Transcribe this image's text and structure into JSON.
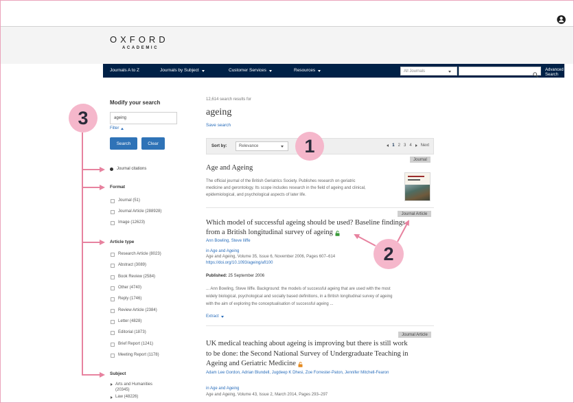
{
  "header": {
    "user_icon": "user-circle-icon"
  },
  "logo": {
    "word": "OXFORD",
    "sub": "ACADEMIC"
  },
  "nav": {
    "items": [
      {
        "label": "Journals A to Z",
        "has_caret": false
      },
      {
        "label": "Journals by Subject",
        "has_caret": true
      },
      {
        "label": "Customer Services",
        "has_caret": true
      },
      {
        "label": "Resources",
        "has_caret": true
      }
    ],
    "scope": "All Journals",
    "advanced_line1": "Advanced",
    "advanced_line2": "Search",
    "search_icon": "search-icon",
    "background": "#002147"
  },
  "sidebar": {
    "title": "Modify your search",
    "query": "ageing",
    "filter_label": "Filter",
    "search_button": "Search",
    "clear_button": "Clear",
    "scope_option": "Journal citations",
    "format": {
      "heading": "Format",
      "options": [
        "Journal (51)",
        "Journal Article (288928)",
        "Image (12623)"
      ]
    },
    "article_type": {
      "heading": "Article type",
      "options": [
        "Research Article (8023)",
        "Abstract (3089)",
        "Book Review (2584)",
        "Other (4740)",
        "Reply (1746)",
        "Review Article (2384)",
        "Letter (4828)",
        "Editorial (1873)",
        "Brief Report (1241)",
        "Meeting Report (1178)"
      ]
    },
    "subject": {
      "heading": "Subject",
      "options": [
        "Arts and Humanities (20345)",
        "Law (48226)"
      ]
    }
  },
  "results": {
    "count_text": "12,614 search results for",
    "query": "ageing",
    "save_search": "Save search",
    "sort_label": "Sort by:",
    "sort_value": "Relevance",
    "pages": [
      "1",
      "2",
      "3",
      "4"
    ],
    "next": "Next",
    "items": [
      {
        "type": "Journal",
        "title": "Age and Ageing",
        "desc_lines": [
          "The official journal of the British Geriatrics Society. Publishes research on geriatric",
          "medicine and gerontology. Its scope includes research in the field of ageing and clinical,",
          "epidemiological, and psychological aspects of later life."
        ],
        "cover": "journal-cover-image"
      },
      {
        "type": "Journal Article",
        "title_lines": [
          "Which model of successful ageing should be used? Baseline findings",
          "from a British longitudinal survey of ageing"
        ],
        "access_icon": "open-access-lock-icon",
        "authors": "Ann Bowling, Steve Iliffe",
        "in_journal": "in Age and Ageing",
        "citation": "Age and Ageing, Volume 35, Issue 6, November 2006, Pages 607–614",
        "doi": "https://doi.org/10.1093/ageing/afl100",
        "published_label": "Published:",
        "published_date": "25 September 2006",
        "snippet_lines": [
          "... Ann Bowling, Steve Iliffe. Background: the models of successful ageing that are used with the most",
          "widely biological, psychological and socially based definitions, in a British longitudinal survey of ageing",
          "with the aim of exploring the conceptualisation of successful ageing ..."
        ],
        "extract": "Extract"
      },
      {
        "type": "Journal Article",
        "title_lines": [
          "UK medical teaching about ageing is improving but there is still work",
          "to be done: the Second National Survey of Undergraduate Teaching in",
          "Ageing and Geriatric Medicine"
        ],
        "access_icon": "free-access-lock-icon",
        "authors": "Adam Lee Gordon, Adrian Blundell, Jugdeep K Dhesi, Zoe Forrester-Paton, Jennifer Mitchell-Fearon",
        "in_journal": "in Age and Ageing",
        "citation": "Age and Ageing, Volume 43, Issue 2, March 2014, Pages 293–297"
      }
    ]
  },
  "annotations": {
    "one": "1",
    "two": "2",
    "three": "3",
    "arrow_color": "#e7829f",
    "circle_color": "#f5b7cb"
  },
  "colors": {
    "link": "#2a6ebb",
    "button": "#2f73b7",
    "open_access": "#3a9a3a",
    "free_access": "#e58a1f"
  }
}
